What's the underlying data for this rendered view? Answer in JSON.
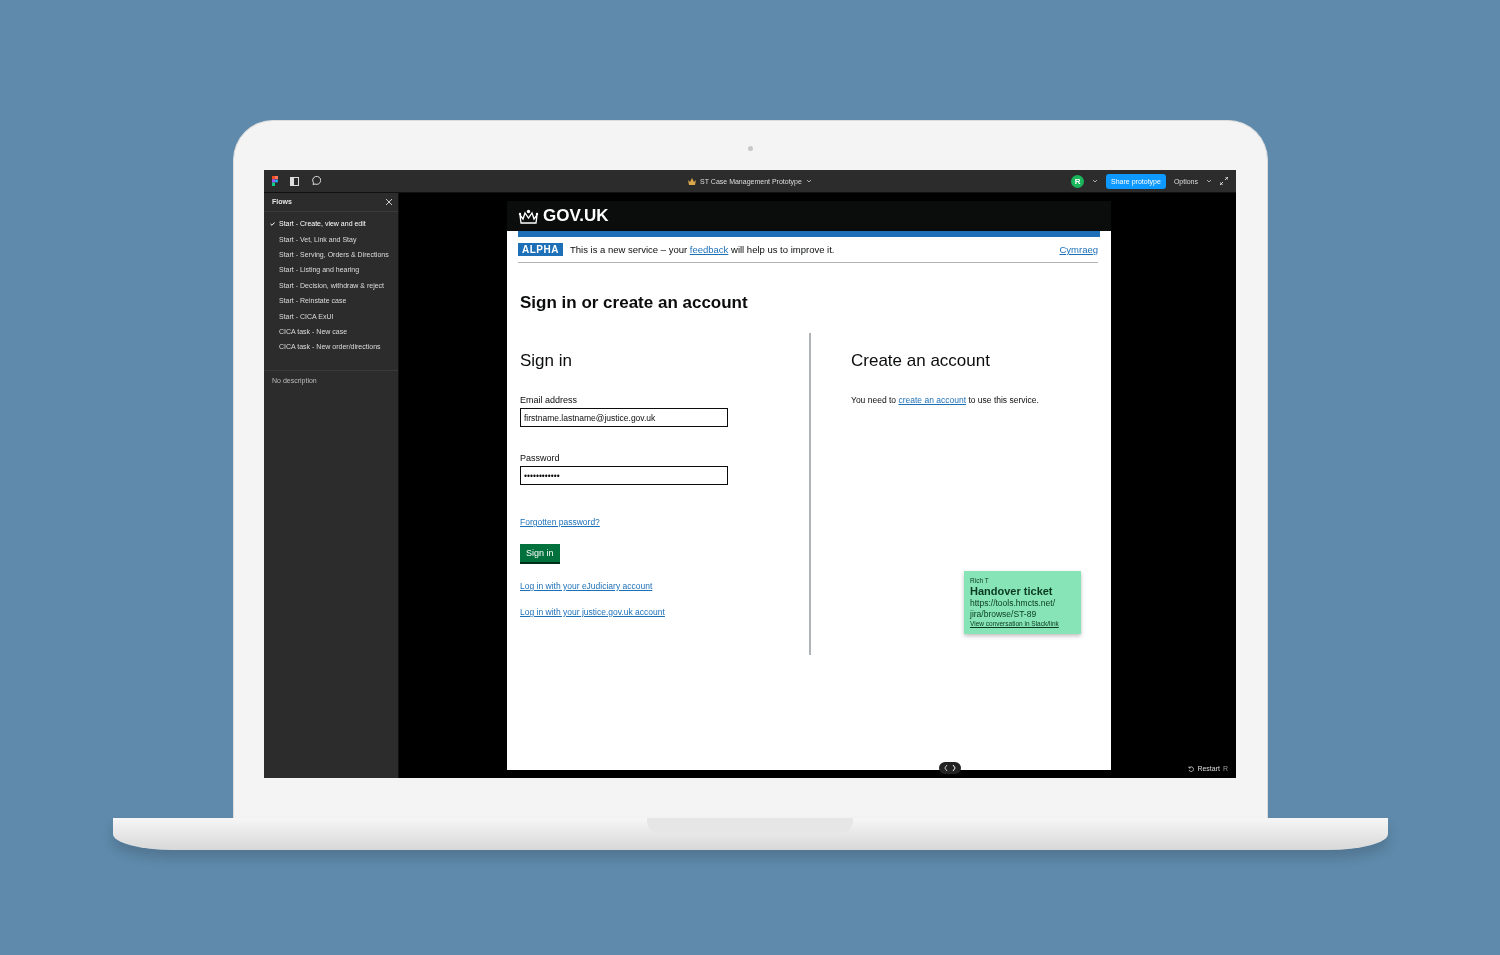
{
  "toolbar": {
    "title": "ST Case Management Prototype",
    "avatar": "R",
    "share_button": "Share prototype",
    "options_button": "Options"
  },
  "flows": {
    "title": "Flows",
    "items": [
      {
        "label": "Start - Create, view and edit",
        "selected": true
      },
      {
        "label": "Start - Vet, Link and Stay",
        "selected": false
      },
      {
        "label": "Start - Serving, Orders & Directions",
        "selected": false
      },
      {
        "label": "Start - Listing and hearing",
        "selected": false
      },
      {
        "label": "Start - Decision, withdraw & reject",
        "selected": false
      },
      {
        "label": "Start - Reinstate case",
        "selected": false
      },
      {
        "label": "Start - CICA ExUI",
        "selected": false
      },
      {
        "label": "CICA task - New case",
        "selected": false
      },
      {
        "label": "CICA task - New order/directions",
        "selected": false
      }
    ],
    "description": "No description"
  },
  "gov_header": {
    "logo": "GOV.UK"
  },
  "phase_banner": {
    "tag": "ALPHA",
    "text_before": "This is a new service – your",
    "link": "feedback",
    "text_after": "will help us to improve it.",
    "language_link": "Cymraeg"
  },
  "heading": "Sign in or create an account",
  "sign_in": {
    "heading": "Sign in",
    "fields": [
      {
        "label": "Email address",
        "value": "firstname.lastname@justice.gov.uk"
      },
      {
        "label": "Password",
        "value": "••••••••••••"
      }
    ],
    "forgotten_link": "Forgotten password?",
    "button": "Sign in",
    "links": [
      "Log in with your eJudiciary account",
      "Log in with your justice.gov.uk account"
    ]
  },
  "create_account": {
    "heading": "Create an account",
    "text_before": "You need to",
    "link": "create an account",
    "text_after": "to use this service."
  },
  "comment": {
    "author": "Rich T",
    "title": "Handover ticket",
    "body": "https://tools.hmcts.net/ jira/browse/ST-89",
    "link": "View conversation in Slack/link"
  },
  "restart": {
    "label": "Restart",
    "shortcut": "R"
  }
}
